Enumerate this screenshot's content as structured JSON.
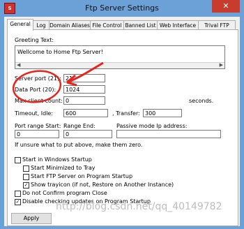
{
  "window": {
    "title": "Ftp Server Settings",
    "close_glyph": "✕",
    "app_icon_glyph": "S"
  },
  "tabs": [
    {
      "label": "General",
      "active": true
    },
    {
      "label": "Log",
      "active": false
    },
    {
      "label": "Domain Aliases",
      "active": false
    },
    {
      "label": "File Control",
      "active": false
    },
    {
      "label": "Banned List",
      "active": false
    },
    {
      "label": "Web Interface",
      "active": false
    },
    {
      "label": "Trival FTP",
      "active": false
    }
  ],
  "general": {
    "greeting_label": "Greeting Text:",
    "greeting_text": "Wellcome to Home Ftp Server!",
    "server_port_label": "Server port (21):",
    "server_port_value": "21",
    "data_port_label": "Data Port (20):",
    "data_port_value": "1024",
    "max_clients_label": "Max client count:",
    "max_clients_value": "0",
    "timeout_label": "Timeout, Idle:",
    "timeout_idle_value": "600",
    "transfer_label": ", Transfer:",
    "timeout_transfer_value": "300",
    "seconds_label": "seconds.",
    "port_range_start_label": "Port range Start:",
    "port_range_start_value": "0",
    "range_end_label": "Range End:",
    "range_end_value": "0",
    "passive_label": "Passive mode Ip address:",
    "passive_value": "",
    "hint_text": "If unsure what to put above, make them zero.",
    "options": [
      {
        "label": "Start in Windows Startup",
        "checked": false
      },
      {
        "label": "Start Minimized to Tray",
        "checked": false
      },
      {
        "label": "Start FTP Server on Program Startup",
        "checked": false
      },
      {
        "label": "Show trayicon (if not, Restore on Another Instance)",
        "checked": true
      },
      {
        "label": "Do not Confirm program Close",
        "checked": false
      },
      {
        "label": "Disable checking updates on Program Startup",
        "checked": true
      }
    ],
    "apply_label": "Apply"
  },
  "annotation": {
    "color": "#e8231e"
  },
  "watermark": "http://blog.csdn.net/qq_40149782"
}
